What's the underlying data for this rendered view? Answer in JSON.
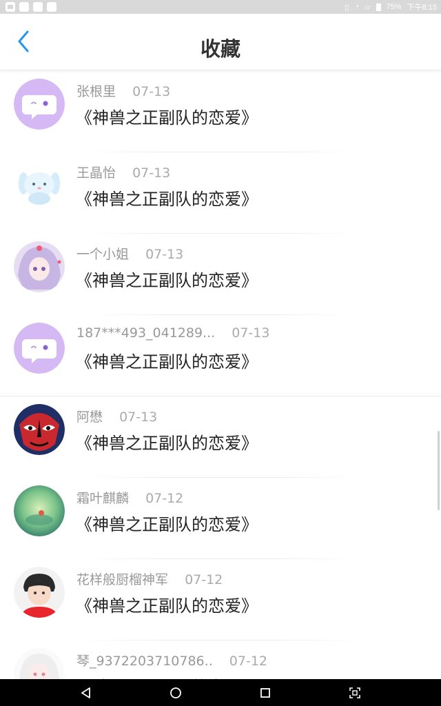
{
  "status_bar": {
    "battery": "75%",
    "time": "下午8:15",
    "icons": [
      "image-icon",
      "app-icon",
      "app-icon",
      "app-icon",
      "vibrate-icon",
      "wifi-icon",
      "sim-icon",
      "battery-icon"
    ]
  },
  "header": {
    "title": "收藏",
    "back_icon": "chevron-left-icon",
    "accent": "#2196f3"
  },
  "favorites": [
    {
      "name": "张根里",
      "date": "07-13",
      "title": "《神兽之正副队的恋爱》",
      "avatar": "chat-bubble-avatar"
    },
    {
      "name": "王晶怡",
      "date": "07-13",
      "title": "《神兽之正副队的恋爱》",
      "avatar": "cartoon-rabbit-avatar"
    },
    {
      "name": "一个小姐",
      "date": "07-13",
      "title": "《神兽之正副队的恋爱》",
      "avatar": "anime-girl-avatar"
    },
    {
      "name": "187***493_041289...",
      "date": "07-13",
      "title": "《神兽之正副队的恋爱》",
      "avatar": "chat-bubble-avatar"
    },
    {
      "name": "阿懋",
      "date": "07-13",
      "title": "《神兽之正副队的恋爱》",
      "avatar": "opera-mask-avatar"
    },
    {
      "name": "霜叶麒麟",
      "date": "07-12",
      "title": "《神兽之正副队的恋爱》",
      "avatar": "green-landscape-avatar"
    },
    {
      "name": "花样般厨榴神军",
      "date": "07-12",
      "title": "《神兽之正副队的恋爱》",
      "avatar": "boy-photo-avatar"
    },
    {
      "name": "琴_9372203710786..",
      "date": "07-12",
      "title": "《神兽之正副队的恋爱》",
      "avatar": "anime-girl-avatar"
    }
  ],
  "nav_bar": {
    "icons": [
      "back-triangle-icon",
      "home-circle-icon",
      "recents-square-icon",
      "screenshot-icon"
    ]
  }
}
